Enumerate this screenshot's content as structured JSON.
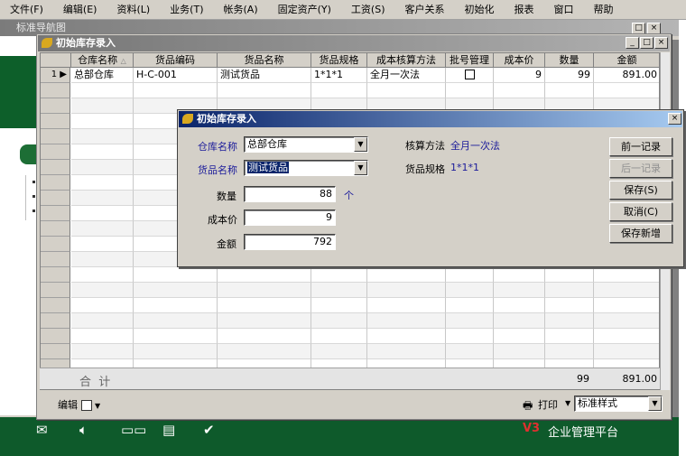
{
  "menu": [
    "文件(F)",
    "编辑(E)",
    "资料(L)",
    "业务(T)",
    "帐务(A)",
    "固定资产(Y)",
    "工资(S)",
    "客户关系",
    "初始化",
    "报表",
    "窗口",
    "帮助"
  ],
  "background_window": {
    "title": "标准导航图",
    "brand_mark": "V3",
    "brand_text": "企业管理平台"
  },
  "main_window": {
    "title": "初始库存录入",
    "columns": [
      "仓库名称",
      "货品编码",
      "货品名称",
      "货品规格",
      "成本核算方法",
      "批号管理",
      "成本价",
      "数量",
      "金额"
    ],
    "rows": [
      {
        "num": "1",
        "warehouse": "总部仓库",
        "code": "H-C-001",
        "name": "测试货品",
        "spec": "1*1*1",
        "method": "全月一次法",
        "batch_managed": false,
        "cost": "9",
        "qty": "99",
        "amount": "891.00"
      }
    ],
    "total_label": "合  计",
    "total_qty": "99",
    "total_amount": "891.00",
    "footer": {
      "edit_label": "编辑",
      "print_label": "打印",
      "style_value": "标准样式"
    }
  },
  "dialog": {
    "title": "初始库存录入",
    "warehouse_label": "仓库名称",
    "warehouse_value": "总部仓库",
    "goods_label": "货品名称",
    "goods_value": "测试货品",
    "qty_label": "数量",
    "qty_value": "88",
    "qty_unit": "个",
    "cost_label": "成本价",
    "cost_value": "9",
    "amount_label": "金额",
    "amount_value": "792",
    "method_label": "核算方法",
    "method_value": "全月一次法",
    "spec_label": "货品规格",
    "spec_value": "1*1*1",
    "buttons": {
      "prev": "前一记录",
      "next": "后一记录",
      "save": "保存(S)",
      "cancel": "取消(C)",
      "save_new": "保存新增"
    }
  },
  "colors": {
    "dialog_title": "#0a246a",
    "inactive_title": "#808080",
    "brand_green": "#0e5a2b",
    "label_blue": "#1a1a9a"
  }
}
